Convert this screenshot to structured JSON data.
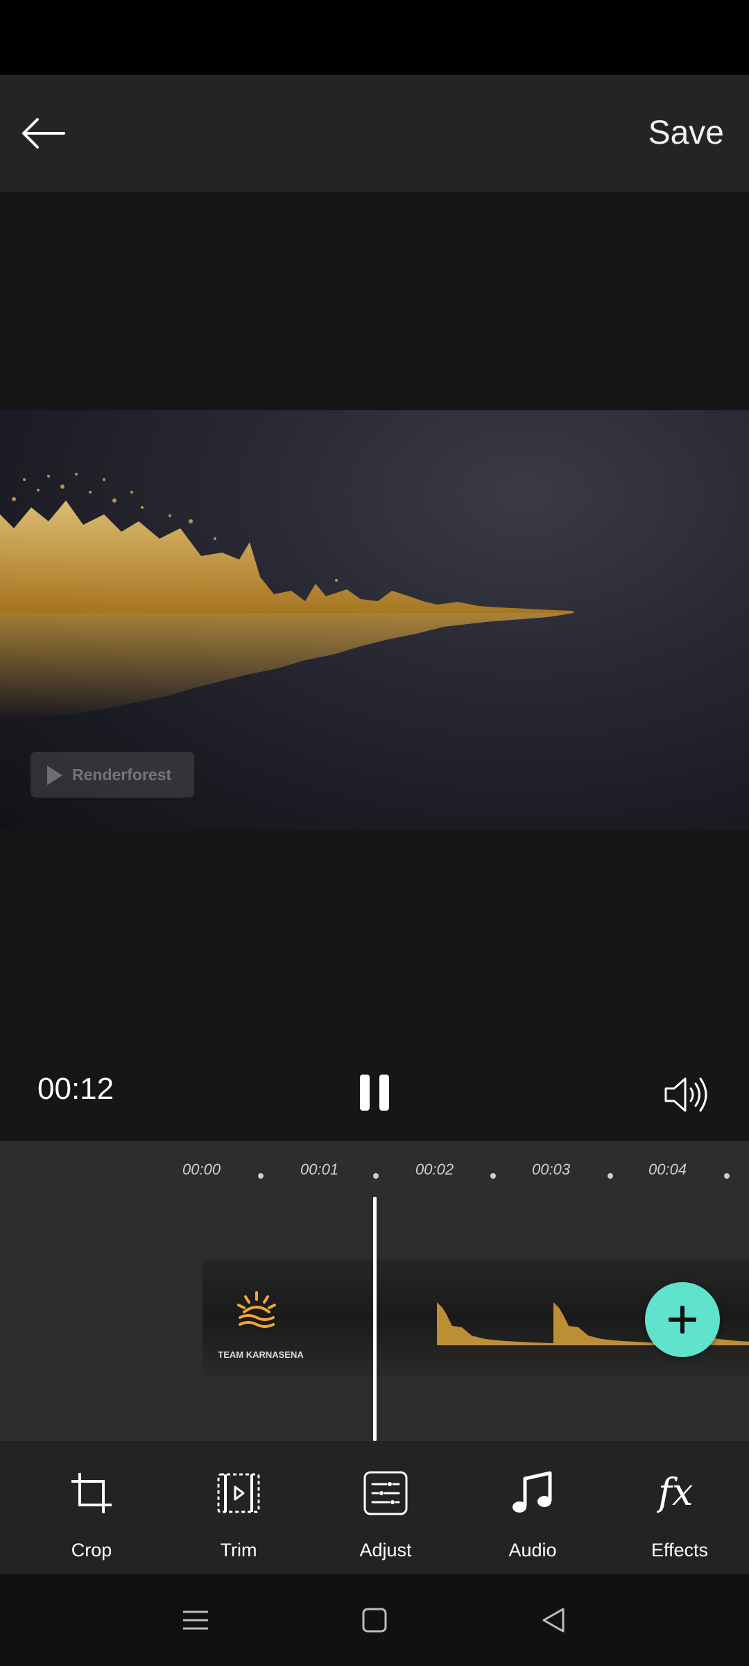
{
  "header": {
    "save_label": "Save"
  },
  "player": {
    "current_time": "00:12",
    "watermark": "Renderforest"
  },
  "timeline": {
    "ticks": [
      "00:00",
      "00:01",
      "00:02",
      "00:03",
      "00:04"
    ],
    "title_clip_text": "TEAM KARNASENA"
  },
  "toolbar": {
    "items": [
      {
        "label": "Crop",
        "icon": "crop-icon"
      },
      {
        "label": "Trim",
        "icon": "trim-icon"
      },
      {
        "label": "Adjust",
        "icon": "adjust-icon"
      },
      {
        "label": "Audio",
        "icon": "music-note-icon"
      },
      {
        "label": "Effects",
        "icon": "fx-icon"
      }
    ]
  },
  "colors": {
    "accent": "#5fe3cc",
    "logo": "#f2a73b"
  }
}
